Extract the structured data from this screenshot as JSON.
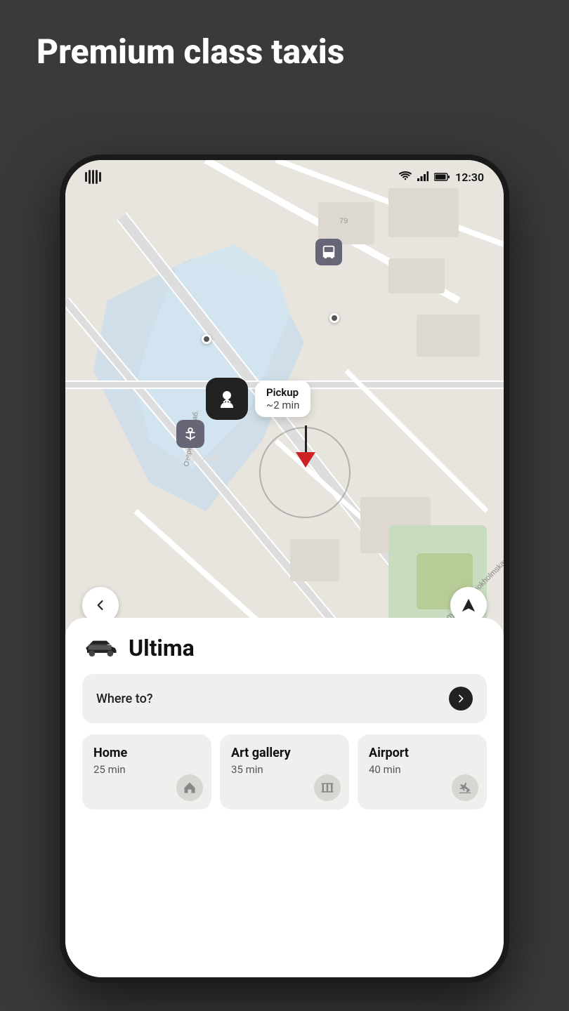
{
  "page": {
    "title": "Premium class taxis",
    "background_color": "#3a3a3a"
  },
  "status_bar": {
    "time": "12:30",
    "vibrate_label": "vibrate-icon",
    "wifi_label": "wifi-icon",
    "signal_label": "signal-icon",
    "battery_label": "battery-icon"
  },
  "map": {
    "pickup_label": "Pickup",
    "pickup_time": "~2 min",
    "location_label": "Ozerkovskiy",
    "street_label": "Nizhnyaya Krasnokholmskaya ulitsa",
    "back_button_label": "back",
    "location_button_label": "my-location"
  },
  "bottom_panel": {
    "service_name": "Ultima",
    "where_to": {
      "label": "Where to?",
      "arrow": ">"
    },
    "destinations": [
      {
        "name": "Home",
        "time": "25 min",
        "icon": "home"
      },
      {
        "name": "Art gallery",
        "time": "35 min",
        "icon": "art-gallery"
      },
      {
        "name": "Airport",
        "time": "40 min",
        "icon": "airport"
      }
    ]
  }
}
